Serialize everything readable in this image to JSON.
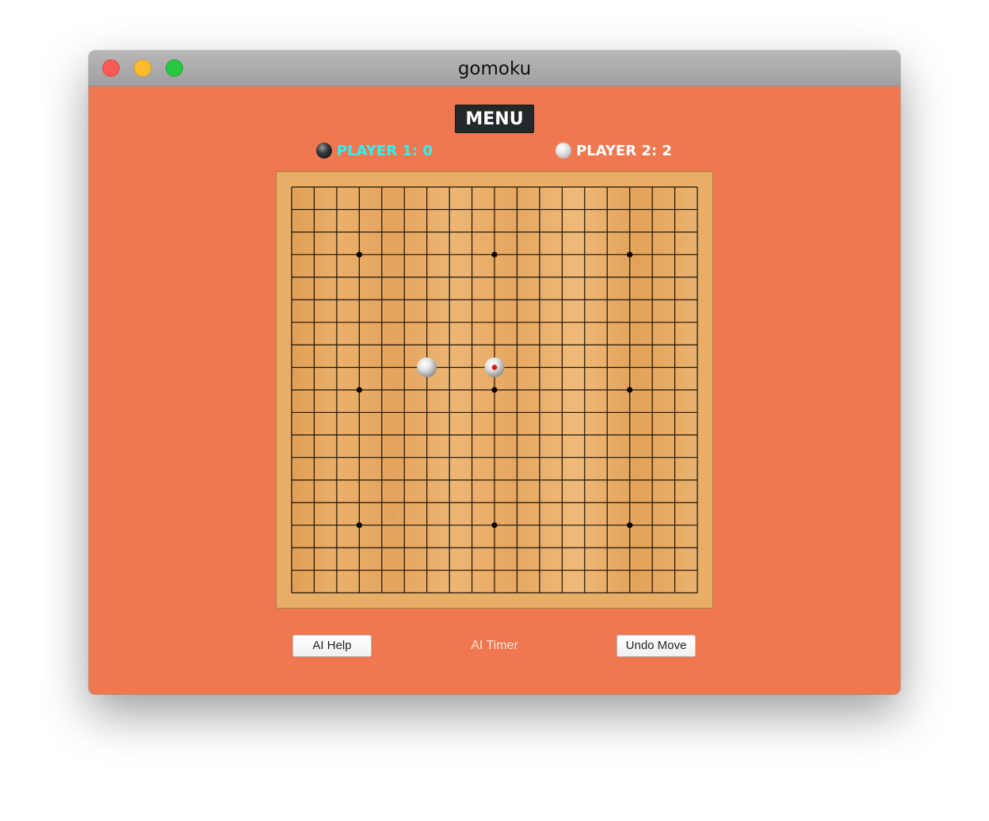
{
  "window": {
    "title": "gomoku",
    "controls": [
      "close",
      "minimize",
      "zoom"
    ],
    "background_color": "#ef7850"
  },
  "menu": {
    "label": "MENU"
  },
  "players": [
    {
      "label": "PLAYER 1: 0",
      "stone": "black",
      "color": "#2cf3f3"
    },
    {
      "label": "PLAYER 2: 2",
      "stone": "white",
      "color": "#ffffff"
    }
  ],
  "board": {
    "grid_size": 19,
    "background_color": "#e8ad66",
    "star_points": [
      [
        3,
        3
      ],
      [
        3,
        9
      ],
      [
        3,
        15
      ],
      [
        9,
        3
      ],
      [
        9,
        9
      ],
      [
        9,
        15
      ],
      [
        15,
        3
      ],
      [
        15,
        9
      ],
      [
        15,
        15
      ]
    ],
    "stones": [
      {
        "row": 8,
        "col": 6,
        "color": "white",
        "last_move": false
      },
      {
        "row": 8,
        "col": 9,
        "color": "white",
        "last_move": true
      }
    ]
  },
  "controls": {
    "ai_help_label": "AI Help",
    "ai_timer_label": "AI Timer",
    "undo_label": "Undo Move"
  }
}
